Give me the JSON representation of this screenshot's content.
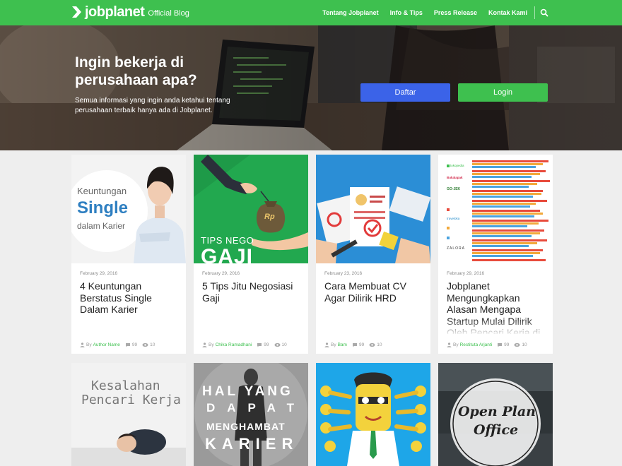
{
  "header": {
    "brand": "jobplanet",
    "brand_sub": "Official Blog",
    "nav": [
      "Tentang Jobplanet",
      "Info & Tips",
      "Press Release",
      "Kontak Kami"
    ]
  },
  "hero": {
    "title": "Ingin bekerja di perusahaan apa?",
    "subtitle": "Semua informasi yang ingin anda ketahui tentang perusahaan terbaik hanya ada di Jobplanet.",
    "register_label": "Daftar",
    "login_label": "Login"
  },
  "by_label": "By",
  "articles": [
    {
      "date": "February 29, 2016",
      "title": "4 Keuntungan Berstatus Single Dalam Karier",
      "author": "Author Name",
      "comments": "99",
      "views": "10",
      "thumb_lines": [
        "Keuntungan",
        "Single",
        "dalam Karier"
      ]
    },
    {
      "date": "February 29, 2016",
      "title": "5 Tips Jitu Negosiasi Gaji",
      "author": "Chika Ramadhani",
      "comments": "99",
      "views": "10",
      "thumb_lines": [
        "TIPS NEGO",
        "GAJI",
        "Rp"
      ]
    },
    {
      "date": "February 23, 2016",
      "title": "Cara Membuat CV Agar Dilirik HRD",
      "author": "Bam",
      "comments": "99",
      "views": "10"
    },
    {
      "date": "February 29, 2016",
      "title": "Jobplanet Mengungkapkan Alasan Mengapa Startup Mulai Dilirik Oleh Pencari Kerja di",
      "author": "Restituta Arjanti",
      "comments": "99",
      "views": "10",
      "thumb_lines": [
        "tokopedia",
        "Bukalapak",
        "GO-JEK",
        "traveloka",
        "ZALORA"
      ]
    }
  ],
  "row2": [
    {
      "thumb_lines": [
        "Kesalahan",
        "Pencari Kerja"
      ]
    },
    {
      "thumb_lines": [
        "HAL YANG",
        "DAPAT",
        "MENGHAMBAT",
        "KARIER"
      ]
    },
    {},
    {
      "thumb_lines": [
        "Open Plan",
        "Office"
      ]
    }
  ],
  "colors": {
    "brand_green": "#3ec04f",
    "register_blue": "#3b63e8",
    "link_green": "#3ec04f"
  }
}
